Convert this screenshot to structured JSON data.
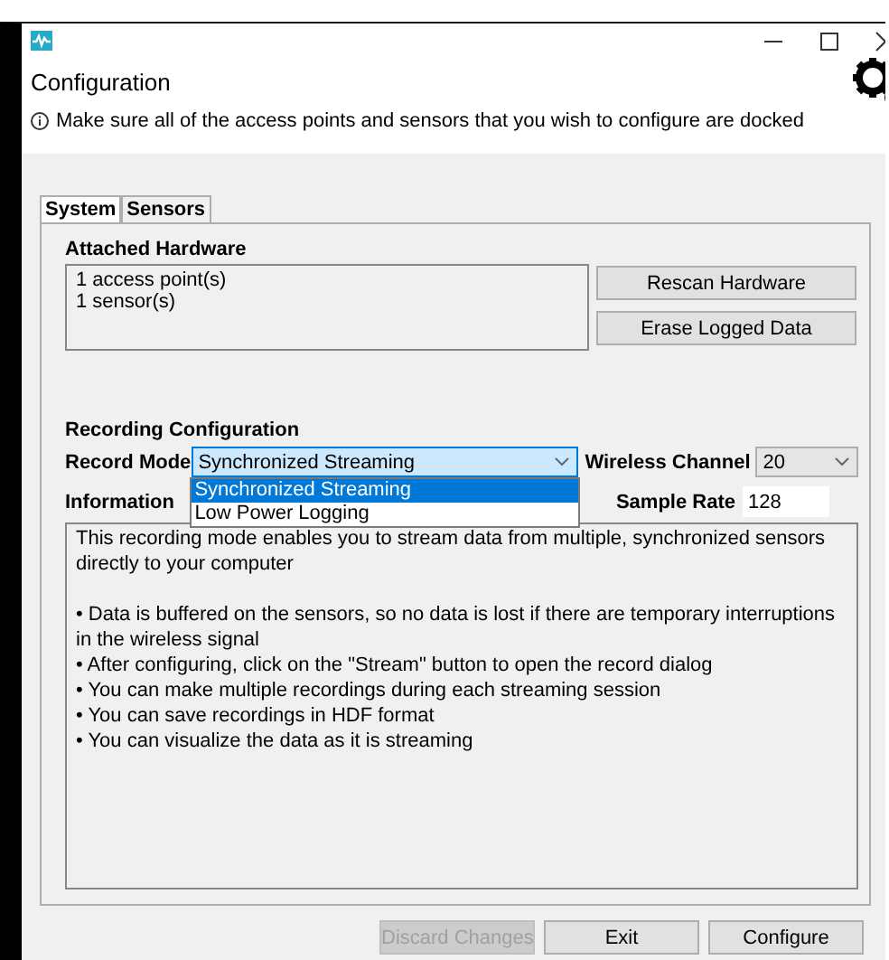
{
  "header": {
    "title": "Configuration",
    "info": "Make sure all of the access points and sensors that you wish to configure are docked"
  },
  "tabs": [
    {
      "label": "System",
      "selected": true
    },
    {
      "label": "Sensors",
      "selected": false
    }
  ],
  "attached_hardware": {
    "title": "Attached Hardware",
    "lines": [
      "1 access point(s)",
      "1 sensor(s)"
    ],
    "buttons": [
      "Rescan Hardware",
      "Erase Logged Data"
    ]
  },
  "recording": {
    "title": "Recording Configuration",
    "record_mode": {
      "label": "Record Mode",
      "value": "Synchronized Streaming",
      "expanded": true,
      "options": [
        {
          "label": "Synchronized Streaming",
          "selected": true
        },
        {
          "label": "Low Power Logging",
          "selected": false
        }
      ]
    },
    "wireless_channel": {
      "label": "Wireless Channel",
      "value": "20"
    },
    "information_label": "Information",
    "sample_rate": {
      "label": "Sample Rate",
      "value": "128"
    },
    "information": [
      {
        "text": "This recording mode enables you to stream data from multiple, synchronized sensors directly to your computer",
        "kind": "paragraph"
      },
      {
        "text": "• Data is buffered on the sensors, so no data is lost if there are temporary interruptions in the wireless signal",
        "kind": "bullet"
      },
      {
        "text": "• After configuring, click on the \"Stream\" button to open the record dialog",
        "kind": "bullet"
      },
      {
        "text": "• You can make multiple recordings during each streaming session",
        "kind": "bullet"
      },
      {
        "text": "• You can save recordings in HDF format",
        "kind": "bullet"
      },
      {
        "text": "• You can visualize the data as it is streaming",
        "kind": "bullet"
      }
    ]
  },
  "footer_buttons": [
    {
      "label": "Discard Changes",
      "disabled": true
    },
    {
      "label": "Exit",
      "disabled": false
    },
    {
      "label": "Configure",
      "disabled": false
    }
  ]
}
